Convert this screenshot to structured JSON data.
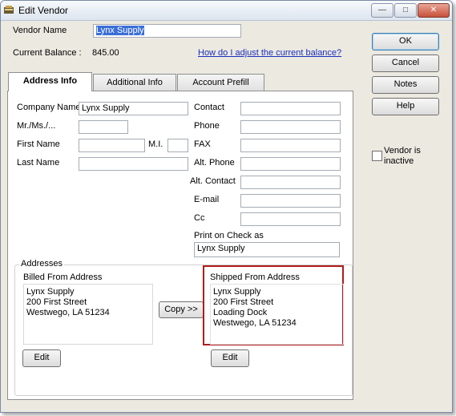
{
  "window": {
    "title": "Edit Vendor",
    "controls": {
      "minimize": "—",
      "maximize": "□",
      "close": "✕"
    }
  },
  "header": {
    "vendor_name_label": "Vendor Name",
    "vendor_name_value": "Lynx Supply",
    "current_balance_label": "Current Balance :",
    "current_balance_value": "845.00",
    "adjust_balance_link": "How do I adjust the current balance?"
  },
  "tabs": [
    {
      "label": "Address Info",
      "active": true
    },
    {
      "label": "Additional Info",
      "active": false
    },
    {
      "label": "Account Prefill",
      "active": false
    }
  ],
  "form": {
    "company_name_label": "Company Name",
    "company_name_value": "Lynx Supply",
    "mr_ms_label": "Mr./Ms./...",
    "mr_ms_value": "",
    "first_name_label": "First Name",
    "first_name_value": "",
    "mi_label": "M.I.",
    "mi_value": "",
    "last_name_label": "Last Name",
    "last_name_value": "",
    "contact_label": "Contact",
    "phone_label": "Phone",
    "fax_label": "FAX",
    "alt_phone_label": "Alt. Phone",
    "alt_contact_label": "Alt. Contact",
    "email_label": "E-mail",
    "cc_label": "Cc",
    "print_on_check_label": "Print on Check as",
    "print_on_check_value": "Lynx Supply"
  },
  "addresses": {
    "group_label": "Addresses",
    "billed_from_label": "Billed From Address",
    "billed_lines": [
      "Lynx Supply",
      "200 First Street",
      "Westwego, LA 51234"
    ],
    "shipped_from_label": "Shipped From Address",
    "shipped_lines": [
      "Lynx Supply",
      "200 First Street",
      "Loading Dock",
      "Westwego, LA 51234"
    ],
    "copy_button": "Copy >>",
    "edit_billed_button": "Edit",
    "edit_shipped_button": "Edit",
    "highlight_color": "#b01c1c"
  },
  "side_buttons": {
    "ok": "OK",
    "cancel": "Cancel",
    "notes": "Notes",
    "help": "Help"
  },
  "inactive": {
    "label_line1": "Vendor is",
    "label_line2": "inactive",
    "checked": false
  }
}
